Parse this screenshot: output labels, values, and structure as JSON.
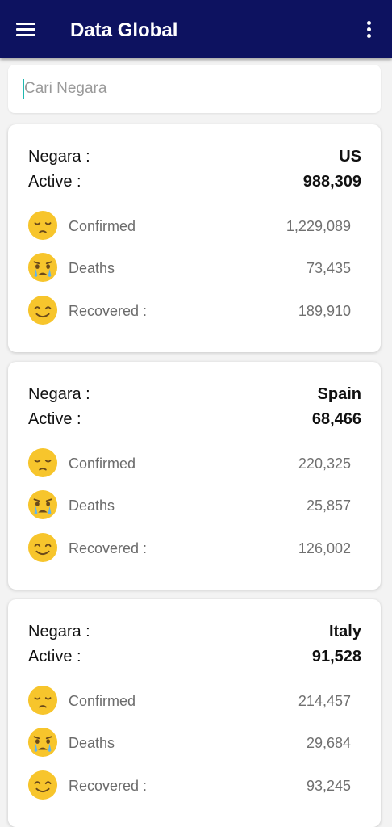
{
  "appbar": {
    "title": "Data Global"
  },
  "search": {
    "placeholder": "Cari Negara",
    "value": ""
  },
  "labels": {
    "negara": "Negara :",
    "active": "Active :",
    "confirmed": "Confirmed",
    "deaths": "Deaths",
    "recovered": "Recovered :"
  },
  "icons": {
    "confirmed": "pensive-face-icon",
    "deaths": "crying-face-icon",
    "recovered": "smiling-face-icon"
  },
  "countries": [
    {
      "name": "US",
      "active": "988,309",
      "confirmed": "1,229,089",
      "deaths": "73,435",
      "recovered": "189,910"
    },
    {
      "name": "Spain",
      "active": "68,466",
      "confirmed": "220,325",
      "deaths": "25,857",
      "recovered": "126,002"
    },
    {
      "name": "Italy",
      "active": "91,528",
      "confirmed": "214,457",
      "deaths": "29,684",
      "recovered": "93,245"
    }
  ],
  "colors": {
    "appbar": "#0d1260",
    "emoji_face": "#f7c52c",
    "cursor": "#1fb8b0"
  }
}
